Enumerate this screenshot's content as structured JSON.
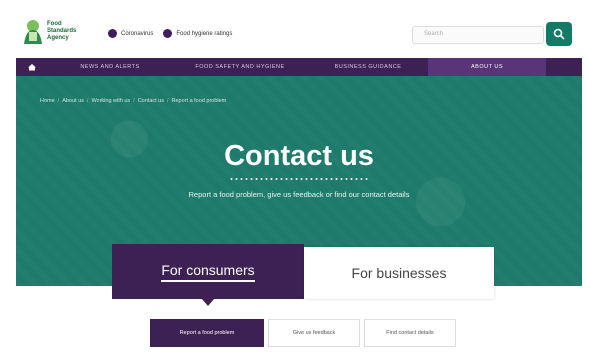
{
  "header": {
    "logo_text": "Food Standards Agency",
    "quick_links": [
      "Coronavirus",
      "Food hygiene ratings"
    ],
    "search_placeholder": "Search"
  },
  "nav": {
    "items": [
      "News and alerts",
      "Food safety and hygiene",
      "Business guidance",
      "About us"
    ],
    "active": "About us"
  },
  "breadcrumb": [
    "Home",
    "About us",
    "Working with us",
    "Contact us",
    "Report a food problem"
  ],
  "hero": {
    "title": "Contact us",
    "subtitle": "Report a food problem, give us feedback or find our contact details"
  },
  "tabs": {
    "consumers": "For consumers",
    "businesses": "For businesses"
  },
  "subnav": [
    "Report a food problem",
    "Give us feedback",
    "Find contact details"
  ],
  "colors": {
    "purple": "#3d2054",
    "teal": "#1e7a6a",
    "search_button": "#147a66"
  }
}
